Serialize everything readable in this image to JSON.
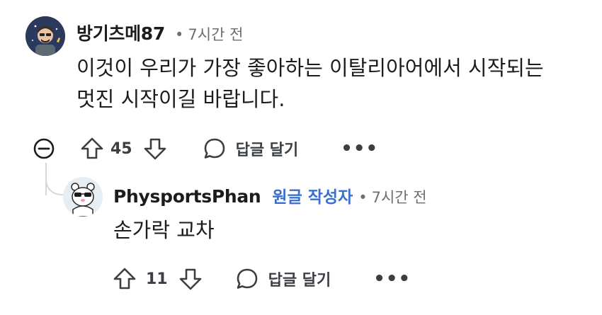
{
  "comments": [
    {
      "username": "방기츠메87",
      "time": "7시간 전",
      "text": "이것이 우리가 가장 좋아하는 이탈리아어에서 시작되는\n멋진 시작이길 바랍니다.",
      "votes": "45",
      "reply_label": "답글 달기",
      "more_label": "•••"
    },
    {
      "username": "PhysportsPhan",
      "op_badge": "원글 작성자",
      "time": "7시간 전",
      "text": "손가락 교차",
      "votes": "11",
      "reply_label": "답글 달기",
      "more_label": "•••"
    }
  ],
  "separator": "•",
  "icons": [
    "collapse-icon",
    "upvote-icon",
    "downvote-icon",
    "reply-bubble-icon",
    "more-icon"
  ],
  "colors": {
    "op_badge": "#3a6fcf",
    "meta": "#6b6f73",
    "thread_line": "#d5d8db"
  }
}
